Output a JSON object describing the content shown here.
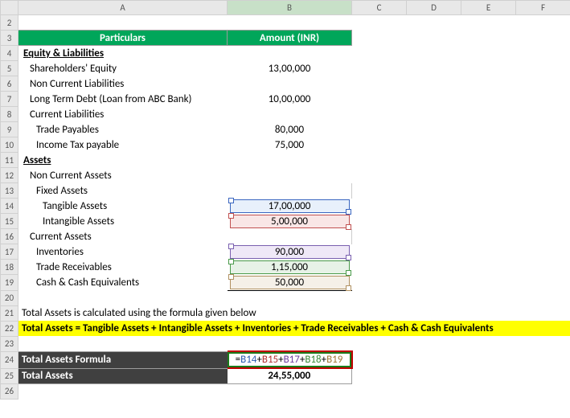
{
  "columns": [
    "A",
    "B",
    "C",
    "D",
    "E",
    "F"
  ],
  "rows": [
    "2",
    "3",
    "4",
    "5",
    "6",
    "7",
    "8",
    "9",
    "10",
    "11",
    "12",
    "13",
    "14",
    "15",
    "16",
    "17",
    "18",
    "19",
    "20",
    "21",
    "22",
    "23",
    "24",
    "25",
    "26"
  ],
  "header": {
    "particulars": "Particulars",
    "amount": "Amount (INR)"
  },
  "equity_liab": "Equity & Liabilities",
  "sh_equity": {
    "label": "Shareholders' Equity",
    "value": "13,00,000"
  },
  "non_curr_liab": "Non Current Liabilities",
  "ltd": {
    "label": " Long Term Debt (Loan from ABC Bank)",
    "value": "10,00,000"
  },
  "curr_liab": "Current Liabilities",
  "tp": {
    "label": "Trade Payables",
    "value": "80,000"
  },
  "it": {
    "label": "Income Tax payable",
    "value": "75,000"
  },
  "assets": "Assets",
  "nca": "Non Current Assets",
  "fa": "Fixed Assets",
  "ta": {
    "label": "Tangible Assets",
    "value": "17,00,000"
  },
  "ia": {
    "label": "Intangible Assets",
    "value": "5,00,000"
  },
  "ca": "Current Assets",
  "inv": {
    "label": "Inventories",
    "value": "90,000"
  },
  "tr": {
    "label": "Trade Receivables",
    "value": "1,15,000"
  },
  "cce": {
    "label": "Cash & Cash Equivalents",
    "value": "50,000"
  },
  "note": "Total Assets is calculated using the formula given below",
  "formula_text": "Total Assets = Tangible Assets + Intangible Assets + Inventories + Trade Receivables + Cash & Cash Equivalents",
  "taf": {
    "label": "Total Assets Formula"
  },
  "formula": {
    "prefix": "=",
    "b14": "B14",
    "b15": "B15",
    "b17": "B17",
    "b18": "B18",
    "b19": "B19",
    "plus": "+"
  },
  "total": {
    "label": "Total Assets",
    "value": "24,55,000"
  }
}
